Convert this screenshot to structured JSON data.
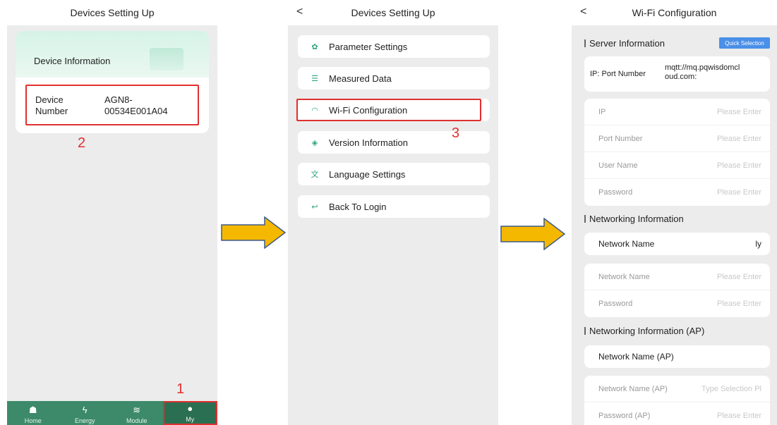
{
  "screen1": {
    "title": "Devices Setting Up",
    "card_title": "Device Information",
    "device_label_line1": "Device",
    "device_label_line2": "Number",
    "device_value_line1": "AGN8-",
    "device_value_line2": "00534E001A04",
    "marker_2": "2",
    "marker_1": "1",
    "nav": [
      {
        "label": "Home",
        "icon": "home-icon",
        "glyph": "☗"
      },
      {
        "label": "Energy",
        "icon": "lightning-icon",
        "glyph": "ϟ"
      },
      {
        "label": "Module",
        "icon": "layers-icon",
        "glyph": "≋"
      },
      {
        "label": "My",
        "icon": "user-icon",
        "glyph": "●"
      }
    ]
  },
  "screen2": {
    "back": "<",
    "title": "Devices Setting Up",
    "marker_3": "3",
    "menu": [
      {
        "label": "Parameter Settings",
        "icon": "gear-icon",
        "glyph": "✿"
      },
      {
        "label": "Measured Data",
        "icon": "sliders-icon",
        "glyph": "☰"
      },
      {
        "label": "Wi-Fi Configuration",
        "icon": "wifi-icon",
        "glyph": "◠"
      },
      {
        "label": "Version Information",
        "icon": "layers-icon",
        "glyph": "◈"
      },
      {
        "label": "Language Settings",
        "icon": "translate-icon",
        "glyph": "文"
      },
      {
        "label": "Back To Login",
        "icon": "logout-icon",
        "glyph": "↩"
      }
    ]
  },
  "screen3": {
    "back": "<",
    "title": "Wi-Fi Configuration",
    "server_section": "Server Information",
    "quick_selection": "Quick Selection",
    "ip_port_label": "IP: Port Number",
    "ip_port_value_line1": "mqtt://mq.pqwisdomcl",
    "ip_port_value_line2": "oud.com:",
    "server_fields": [
      {
        "label": "IP",
        "placeholder": "Please Enter"
      },
      {
        "label": "Port Number",
        "placeholder": "Please Enter"
      },
      {
        "label": "User Name",
        "placeholder": "Please Enter"
      },
      {
        "label": "Password",
        "placeholder": "Please Enter"
      }
    ],
    "net_section": "Networking Information",
    "net_name_label": "Network Name",
    "net_name_value": "ly",
    "net_fields": [
      {
        "label": "Network Name",
        "placeholder": "Please Enter"
      },
      {
        "label": "Password",
        "placeholder": "Please Enter"
      }
    ],
    "ap_section": "Networking Information (AP)",
    "ap_name_label": "Network Name (AP)",
    "ap_fields": [
      {
        "label": "Network Name (AP)",
        "placeholder": "Type Selection  Pl"
      },
      {
        "label": "Password (AP)",
        "placeholder": "Please Enter"
      }
    ]
  },
  "colors": {
    "accent_green": "#3d8a6a",
    "highlight_red": "#e03030",
    "arrow_fill": "#f5b800",
    "button_blue": "#4a8fe8"
  }
}
